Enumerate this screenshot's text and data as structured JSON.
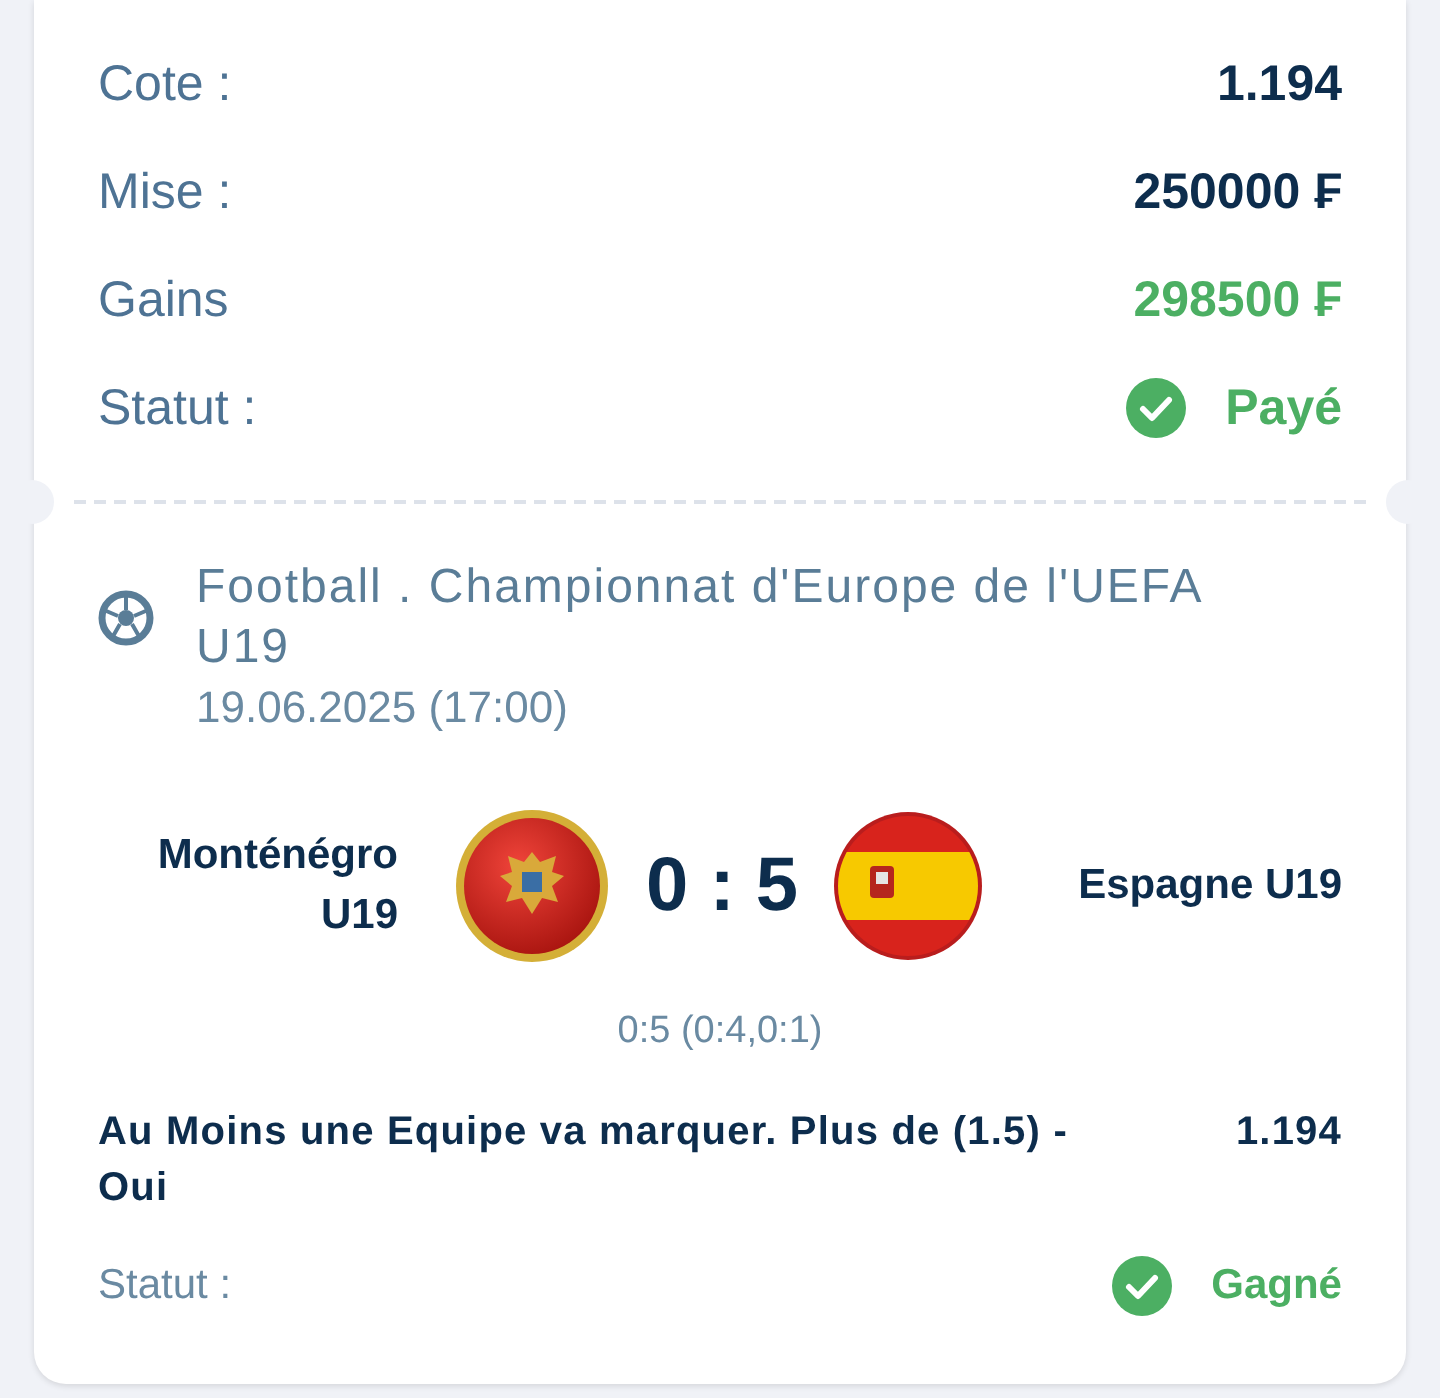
{
  "summary": [
    {
      "kind": "plain",
      "label": "Cote :",
      "value": "1.194"
    },
    {
      "kind": "plain",
      "label": "Mise :",
      "value": "250000 ₣"
    },
    {
      "kind": "gain",
      "label": "Gains",
      "value": "298500 ₣"
    },
    {
      "kind": "status",
      "label": "Statut :",
      "value": "Payé"
    }
  ],
  "event": {
    "title": "Football . Championnat d'Europe de l'UEFA U19",
    "date": "19.06.2025 (17:00)",
    "teams": [
      {
        "name": "Monténégro U19",
        "kind": "montenegro"
      },
      {
        "name": "Espagne U19",
        "kind": "spain"
      }
    ],
    "score": "0 : 5",
    "score_detail": "0:5 (0:4,0:1)",
    "bet": {
      "text": "Au Moins une Equipe va marquer. Plus de (1.5) - Oui",
      "odds": "1.194"
    },
    "status": {
      "label": "Statut :",
      "value": "Gagné"
    }
  }
}
